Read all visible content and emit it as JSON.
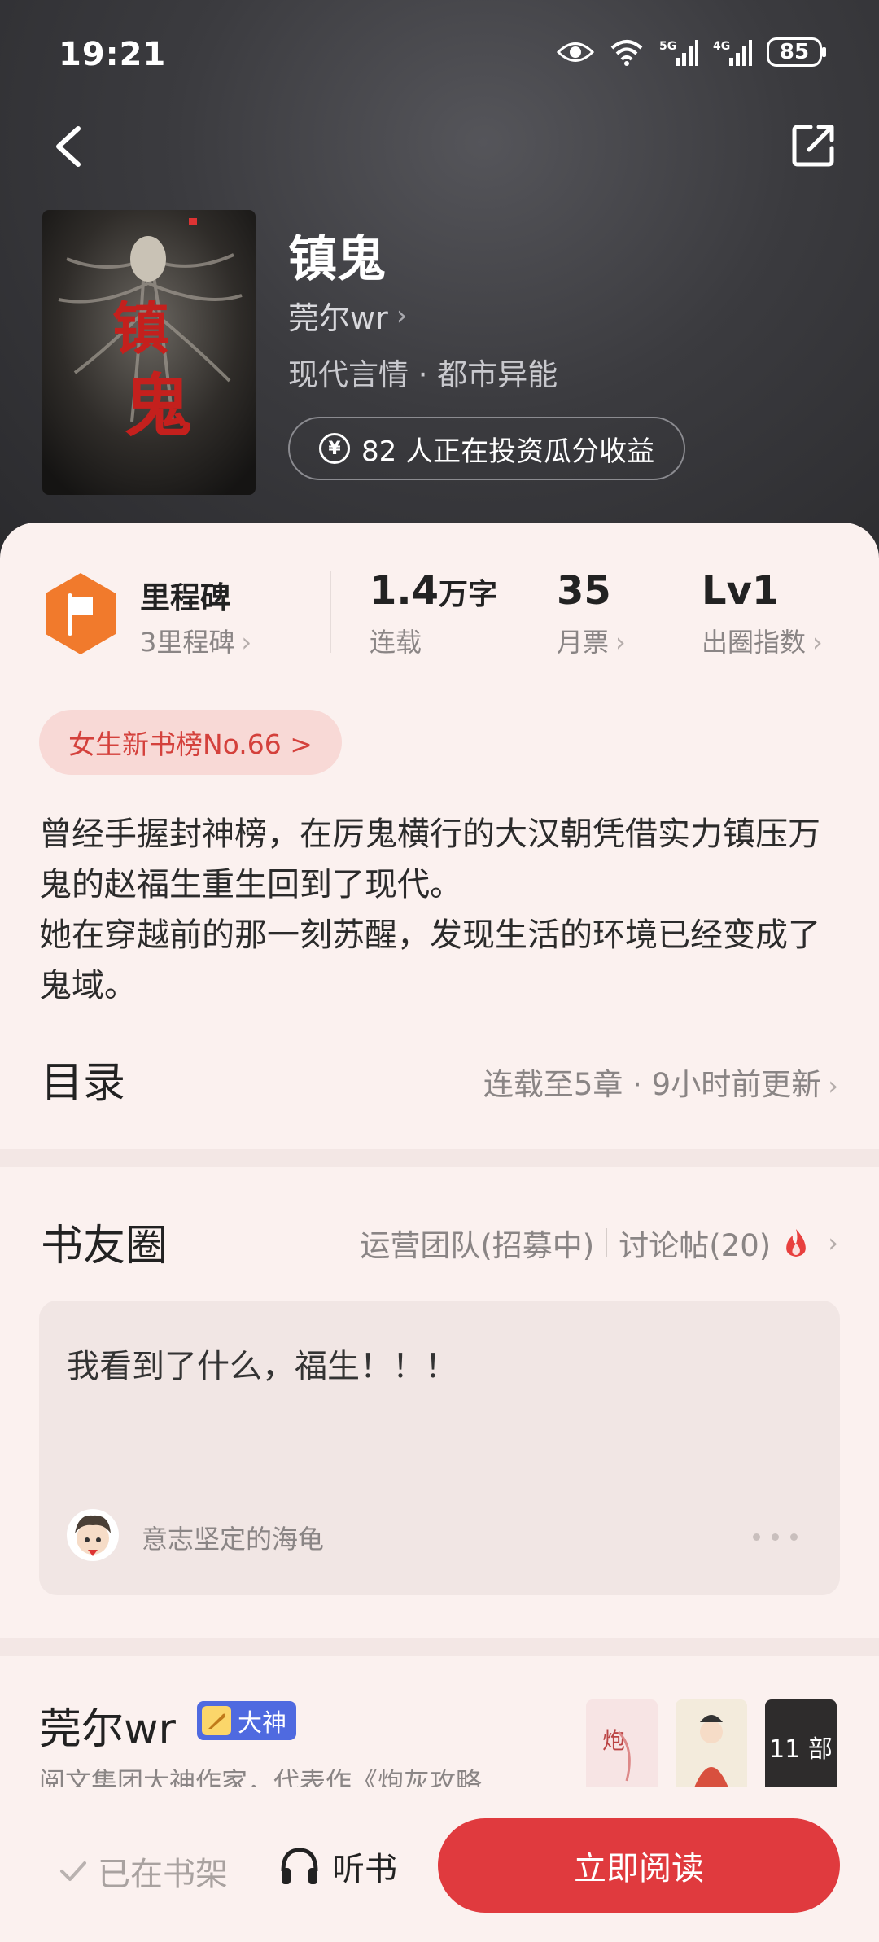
{
  "status_bar": {
    "time": "19:21",
    "battery": "85",
    "net1": "5G",
    "net2": "4G"
  },
  "book": {
    "title": "镇鬼",
    "author": "莞尔wr",
    "genre": "现代言情 · 都市异能",
    "invest_text": "82 人正在投资瓜分收益",
    "cover_text": "镇鬼"
  },
  "stats": {
    "milestone_label": "里程碑",
    "milestone_sub": "3里程碑",
    "words_value": "1.4",
    "words_unit": "万字",
    "words_label": "连载",
    "tickets_value": "35",
    "tickets_label": "月票",
    "level_value": "Lv1",
    "level_label": "出圈指数"
  },
  "rank_tag": "女生新书榜No.66 >",
  "description": [
    "曾经手握封神榜，在厉鬼横行的大汉朝凭借实力镇压万鬼的赵福生重生回到了现代。",
    "她在穿越前的那一刻苏醒，发现生活的环境已经变成了鬼域。"
  ],
  "toc": {
    "title": "目录",
    "meta": "连载至5章 · 9小时前更新"
  },
  "circle": {
    "title": "书友圈",
    "team": "运营团队(招募中)",
    "discuss": "讨论帖(20)",
    "post_text": "我看到了什么，福生！！！",
    "post_user": "意志坚定的海龟"
  },
  "author_section": {
    "name": "莞尔wr",
    "badge": "大神",
    "bio": "阅文集团大神作家，代表作《炮灰攻略…",
    "works_count": "11 部"
  },
  "bottom_bar": {
    "on_shelf": "已在书架",
    "listen": "听书",
    "read": "立即阅读"
  },
  "colors": {
    "accent": "#e03a3e",
    "sheet_bg": "#fbf1ef",
    "badge_blue": "#4f6ae0",
    "rank_bg": "#f8d9d6"
  }
}
